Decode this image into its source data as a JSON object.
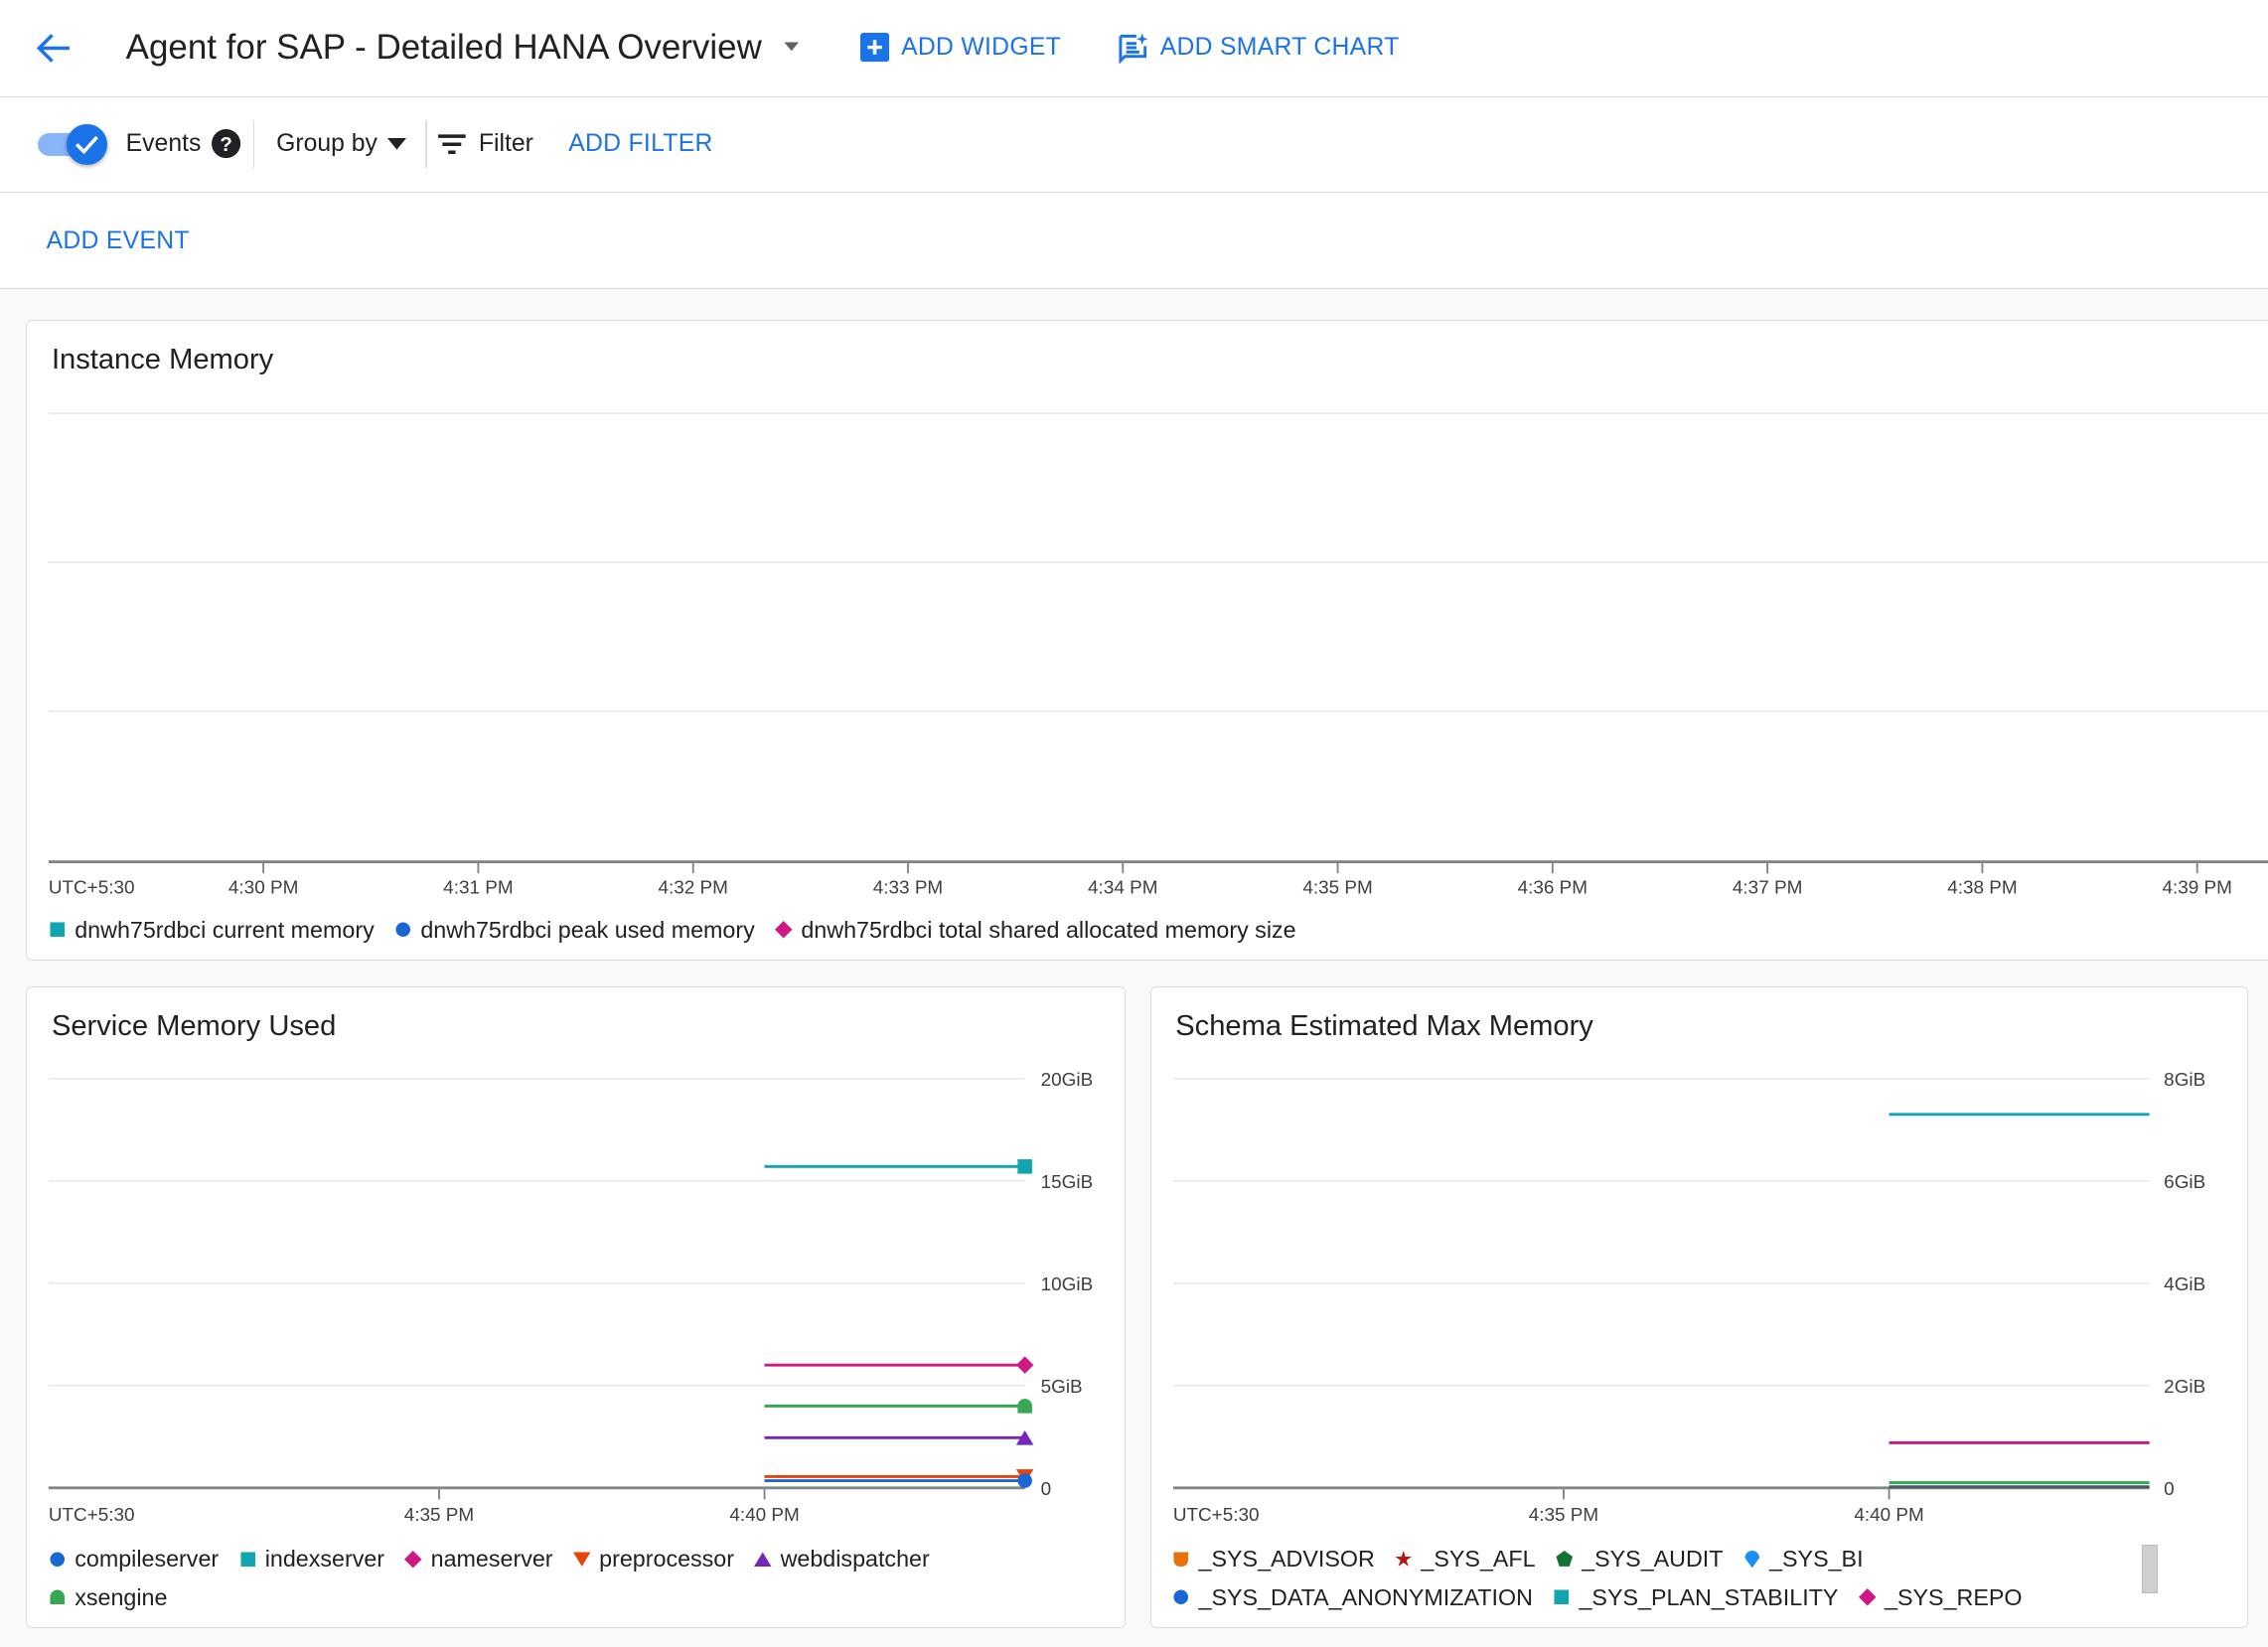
{
  "header": {
    "title": "Agent for SAP - Detailed HANA Overview",
    "add_widget": "ADD WIDGET",
    "add_smart_chart": "ADD SMART CHART"
  },
  "toolbar": {
    "events_label": "Events",
    "events_enabled": true,
    "group_by": "Group by",
    "filter": "Filter",
    "add_filter": "ADD FILTER",
    "add_event": "ADD EVENT"
  },
  "colors": {
    "accent": "#1a73e8",
    "teal": "#12a4af",
    "blue": "#1967d2",
    "pink": "#d01884",
    "orange": "#e8710a",
    "red": "#e8430a",
    "purple": "#7627bb",
    "green": "#34a853",
    "darkgreen": "#137333",
    "darkred": "#b31412",
    "lightblue": "#1e8ef7",
    "slate": "#455a64"
  },
  "charts": [
    {
      "title": "Instance Memory",
      "type": "line",
      "timezone": "UTC+5:30",
      "xlim": [
        "16:29:00",
        "16:39:20"
      ],
      "x_ticks": [
        "4:30 PM",
        "4:31 PM",
        "4:32 PM",
        "4:33 PM",
        "4:34 PM",
        "4:35 PM",
        "4:36 PM",
        "4:37 PM",
        "4:38 PM",
        "4:39 PM"
      ],
      "y_ticks": [],
      "grid": true,
      "legend": [
        {
          "label": "dnwh75rdbci current memory",
          "marker": "square",
          "color": "#12a4af"
        },
        {
          "label": "dnwh75rdbci peak used memory",
          "marker": "circle",
          "color": "#1967d2"
        },
        {
          "label": "dnwh75rdbci total shared allocated memory size",
          "marker": "diamond",
          "color": "#d01884"
        }
      ],
      "series": []
    },
    {
      "title": "Service Memory Used",
      "type": "line",
      "timezone": "UTC+5:30",
      "xlim": [
        "16:29:00",
        "16:44:00"
      ],
      "x_ticks": [
        "4:35 PM",
        "4:40 PM"
      ],
      "ylim": [
        0,
        20
      ],
      "y_ticks": [
        "0",
        "5GiB",
        "10GiB",
        "15GiB",
        "20GiB"
      ],
      "grid": true,
      "legend": [
        {
          "label": "compileserver",
          "marker": "circle",
          "color": "#1967d2"
        },
        {
          "label": "indexserver",
          "marker": "square",
          "color": "#12a4af"
        },
        {
          "label": "nameserver",
          "marker": "diamond",
          "color": "#d01884"
        },
        {
          "label": "preprocessor",
          "marker": "triangle-down",
          "color": "#e8430a"
        },
        {
          "label": "webdispatcher",
          "marker": "triangle-up",
          "color": "#7627bb"
        },
        {
          "label": "xsengine",
          "marker": "bell",
          "color": "#34a853"
        }
      ],
      "series": [
        {
          "name": "indexserver",
          "color": "#12a4af",
          "marker": "square",
          "x": [
            "16:40:00",
            "16:44:00"
          ],
          "y": [
            15.7,
            15.7
          ]
        },
        {
          "name": "nameserver",
          "color": "#d01884",
          "marker": "diamond",
          "x": [
            "16:40:00",
            "16:44:00"
          ],
          "y": [
            6.0,
            6.0
          ]
        },
        {
          "name": "xsengine",
          "color": "#34a853",
          "marker": "bell",
          "x": [
            "16:40:00",
            "16:44:00"
          ],
          "y": [
            4.0,
            4.0
          ]
        },
        {
          "name": "webdispatcher",
          "color": "#7627bb",
          "marker": "triangle-up",
          "x": [
            "16:40:00",
            "16:44:00"
          ],
          "y": [
            2.45,
            2.45
          ]
        },
        {
          "name": "preprocessor",
          "color": "#e8430a",
          "marker": "triangle-down",
          "x": [
            "16:40:00",
            "16:44:00"
          ],
          "y": [
            0.55,
            0.55
          ]
        },
        {
          "name": "compileserver",
          "color": "#1967d2",
          "marker": "circle",
          "x": [
            "16:40:00",
            "16:44:00"
          ],
          "y": [
            0.35,
            0.35
          ]
        }
      ]
    },
    {
      "title": "Schema Estimated Max Memory",
      "type": "line",
      "timezone": "UTC+5:30",
      "xlim": [
        "16:29:00",
        "16:44:00"
      ],
      "x_ticks": [
        "4:35 PM",
        "4:40 PM"
      ],
      "ylim": [
        0,
        8
      ],
      "y_ticks": [
        "0",
        "2GiB",
        "4GiB",
        "6GiB",
        "8GiB"
      ],
      "grid": true,
      "legend": [
        {
          "label": "_SYS_ADVISOR",
          "marker": "shield",
          "color": "#e8710a"
        },
        {
          "label": "_SYS_AFL",
          "marker": "star",
          "color": "#b31412"
        },
        {
          "label": "_SYS_AUDIT",
          "marker": "pentagon",
          "color": "#137333"
        },
        {
          "label": "_SYS_BI",
          "marker": "pin",
          "color": "#1e8ef7"
        },
        {
          "label": "_SYS_DATA_ANONYMIZATION",
          "marker": "circle",
          "color": "#1967d2"
        },
        {
          "label": "_SYS_PLAN_STABILITY",
          "marker": "square",
          "color": "#12a4af"
        },
        {
          "label": "_SYS_REPO",
          "marker": "diamond",
          "color": "#d01884"
        }
      ],
      "series": [
        {
          "color": "#12a4af",
          "x": [
            "16:40:00",
            "16:44:00"
          ],
          "y": [
            7.3,
            7.3
          ]
        },
        {
          "color": "#d01884",
          "x": [
            "16:40:00",
            "16:44:00"
          ],
          "y": [
            0.88,
            0.88
          ]
        },
        {
          "color": "#34a853",
          "x": [
            "16:40:00",
            "16:44:00"
          ],
          "y": [
            0.1,
            0.1
          ]
        },
        {
          "color": "#455a64",
          "x": [
            "16:40:00",
            "16:44:00"
          ],
          "y": [
            0.02,
            0.02
          ]
        }
      ]
    }
  ]
}
